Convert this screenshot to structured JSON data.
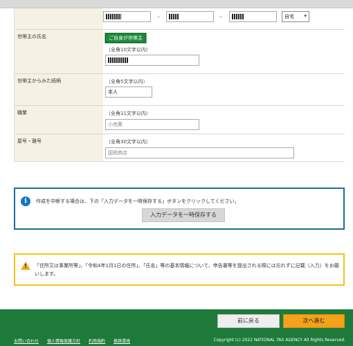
{
  "form": {
    "phone": {
      "part1": "",
      "part2": "",
      "part3": "",
      "dash": "–",
      "type_selected": "自宅",
      "caret": "▾"
    },
    "householder_name": {
      "label": "世帯主の氏名",
      "button": "ご自身が世帯主",
      "hint": "（全角10文字以内）",
      "value": ""
    },
    "relationship": {
      "label": "世帯主からみた続柄",
      "hint": "（全角5文字以内）",
      "value": "本人"
    },
    "occupation": {
      "label": "職業",
      "hint": "（全角11文字以内）",
      "placeholder": "小売業"
    },
    "trade_name": {
      "label": "屋号・雅号",
      "hint": "（全角30文字以内）",
      "placeholder": "国税商店"
    }
  },
  "info_box": {
    "icon": "info-icon",
    "icon_glyph": "i",
    "text": "作成を中断する場合は、下の「入力データを一時保存する」ボタンをクリックしてください。",
    "button": "入力データを一時保存する"
  },
  "warning_box": {
    "icon": "warning-icon",
    "icon_glyph": "!",
    "text": "「住所又は事業所等」、「令和4年1月1日の住所」、「氏名」等の基本情報について、申告書等を提出される際には忘れずに記載（入力）をお願いします。"
  },
  "footer": {
    "back_button": "前に戻る",
    "next_button": "次へ進む",
    "links": [
      "お問い合わせ",
      "個人情報保護方針",
      "利用規約",
      "推奨環境"
    ],
    "copyright": "Copyright (c) 2022 NATIONAL TAX AGENCY All Rights Reserved."
  },
  "colors": {
    "label_bg": "#f5f1e3",
    "footer_bg": "#1e7a3a",
    "next_button": "#f4a21a",
    "info_border": "#1a6e94",
    "warn_border": "#f2c31a"
  }
}
